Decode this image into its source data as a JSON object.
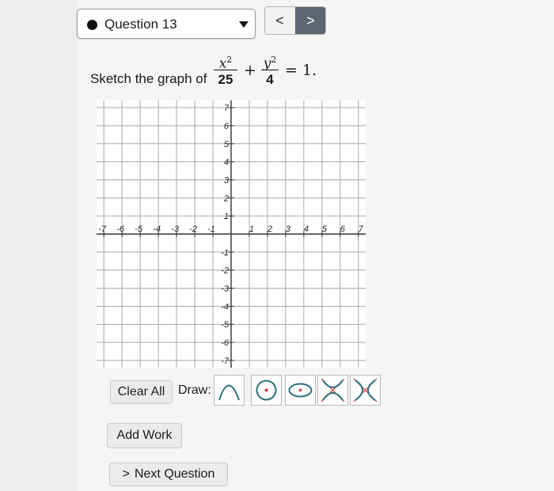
{
  "header": {
    "question_select_value": "Question 13",
    "prev_symbol": "<",
    "next_symbol": ">"
  },
  "prompt": {
    "text": "Sketch the graph of",
    "equation": {
      "term1_numerator": "x",
      "term1_exponent": "2",
      "term1_denominator": "25",
      "plus": "+",
      "term2_numerator": "y",
      "term2_exponent": "2",
      "term2_denominator": "4",
      "equals": "= 1."
    }
  },
  "graph": {
    "x_tick_labels": [
      "-7",
      "-6",
      "-5",
      "-4",
      "-3",
      "-2",
      "-1",
      "1",
      "2",
      "3",
      "4",
      "5",
      "6",
      "7"
    ],
    "y_tick_labels": [
      "7",
      "6",
      "5",
      "4",
      "3",
      "2",
      "1",
      "-1",
      "-2",
      "-3",
      "-4",
      "-5",
      "-6",
      "-7"
    ],
    "x_range": [
      -7,
      7
    ],
    "y_range": [
      -7,
      7
    ],
    "grid": true
  },
  "tools": {
    "clear_label": "Clear All",
    "draw_label": "Draw:",
    "items": [
      {
        "icon": "parabola-icon"
      },
      {
        "icon": "circle-icon"
      },
      {
        "icon": "ellipse-icon"
      },
      {
        "icon": "hyperbola-vertical-icon"
      },
      {
        "icon": "hyperbola-horizontal-icon"
      }
    ],
    "accent_color": "#d33a3a",
    "stroke_color": "#2e6f7a"
  },
  "actions": {
    "add_work_label": "Add Work",
    "next_question_label": "Next Question",
    "next_question_icon": ">"
  }
}
